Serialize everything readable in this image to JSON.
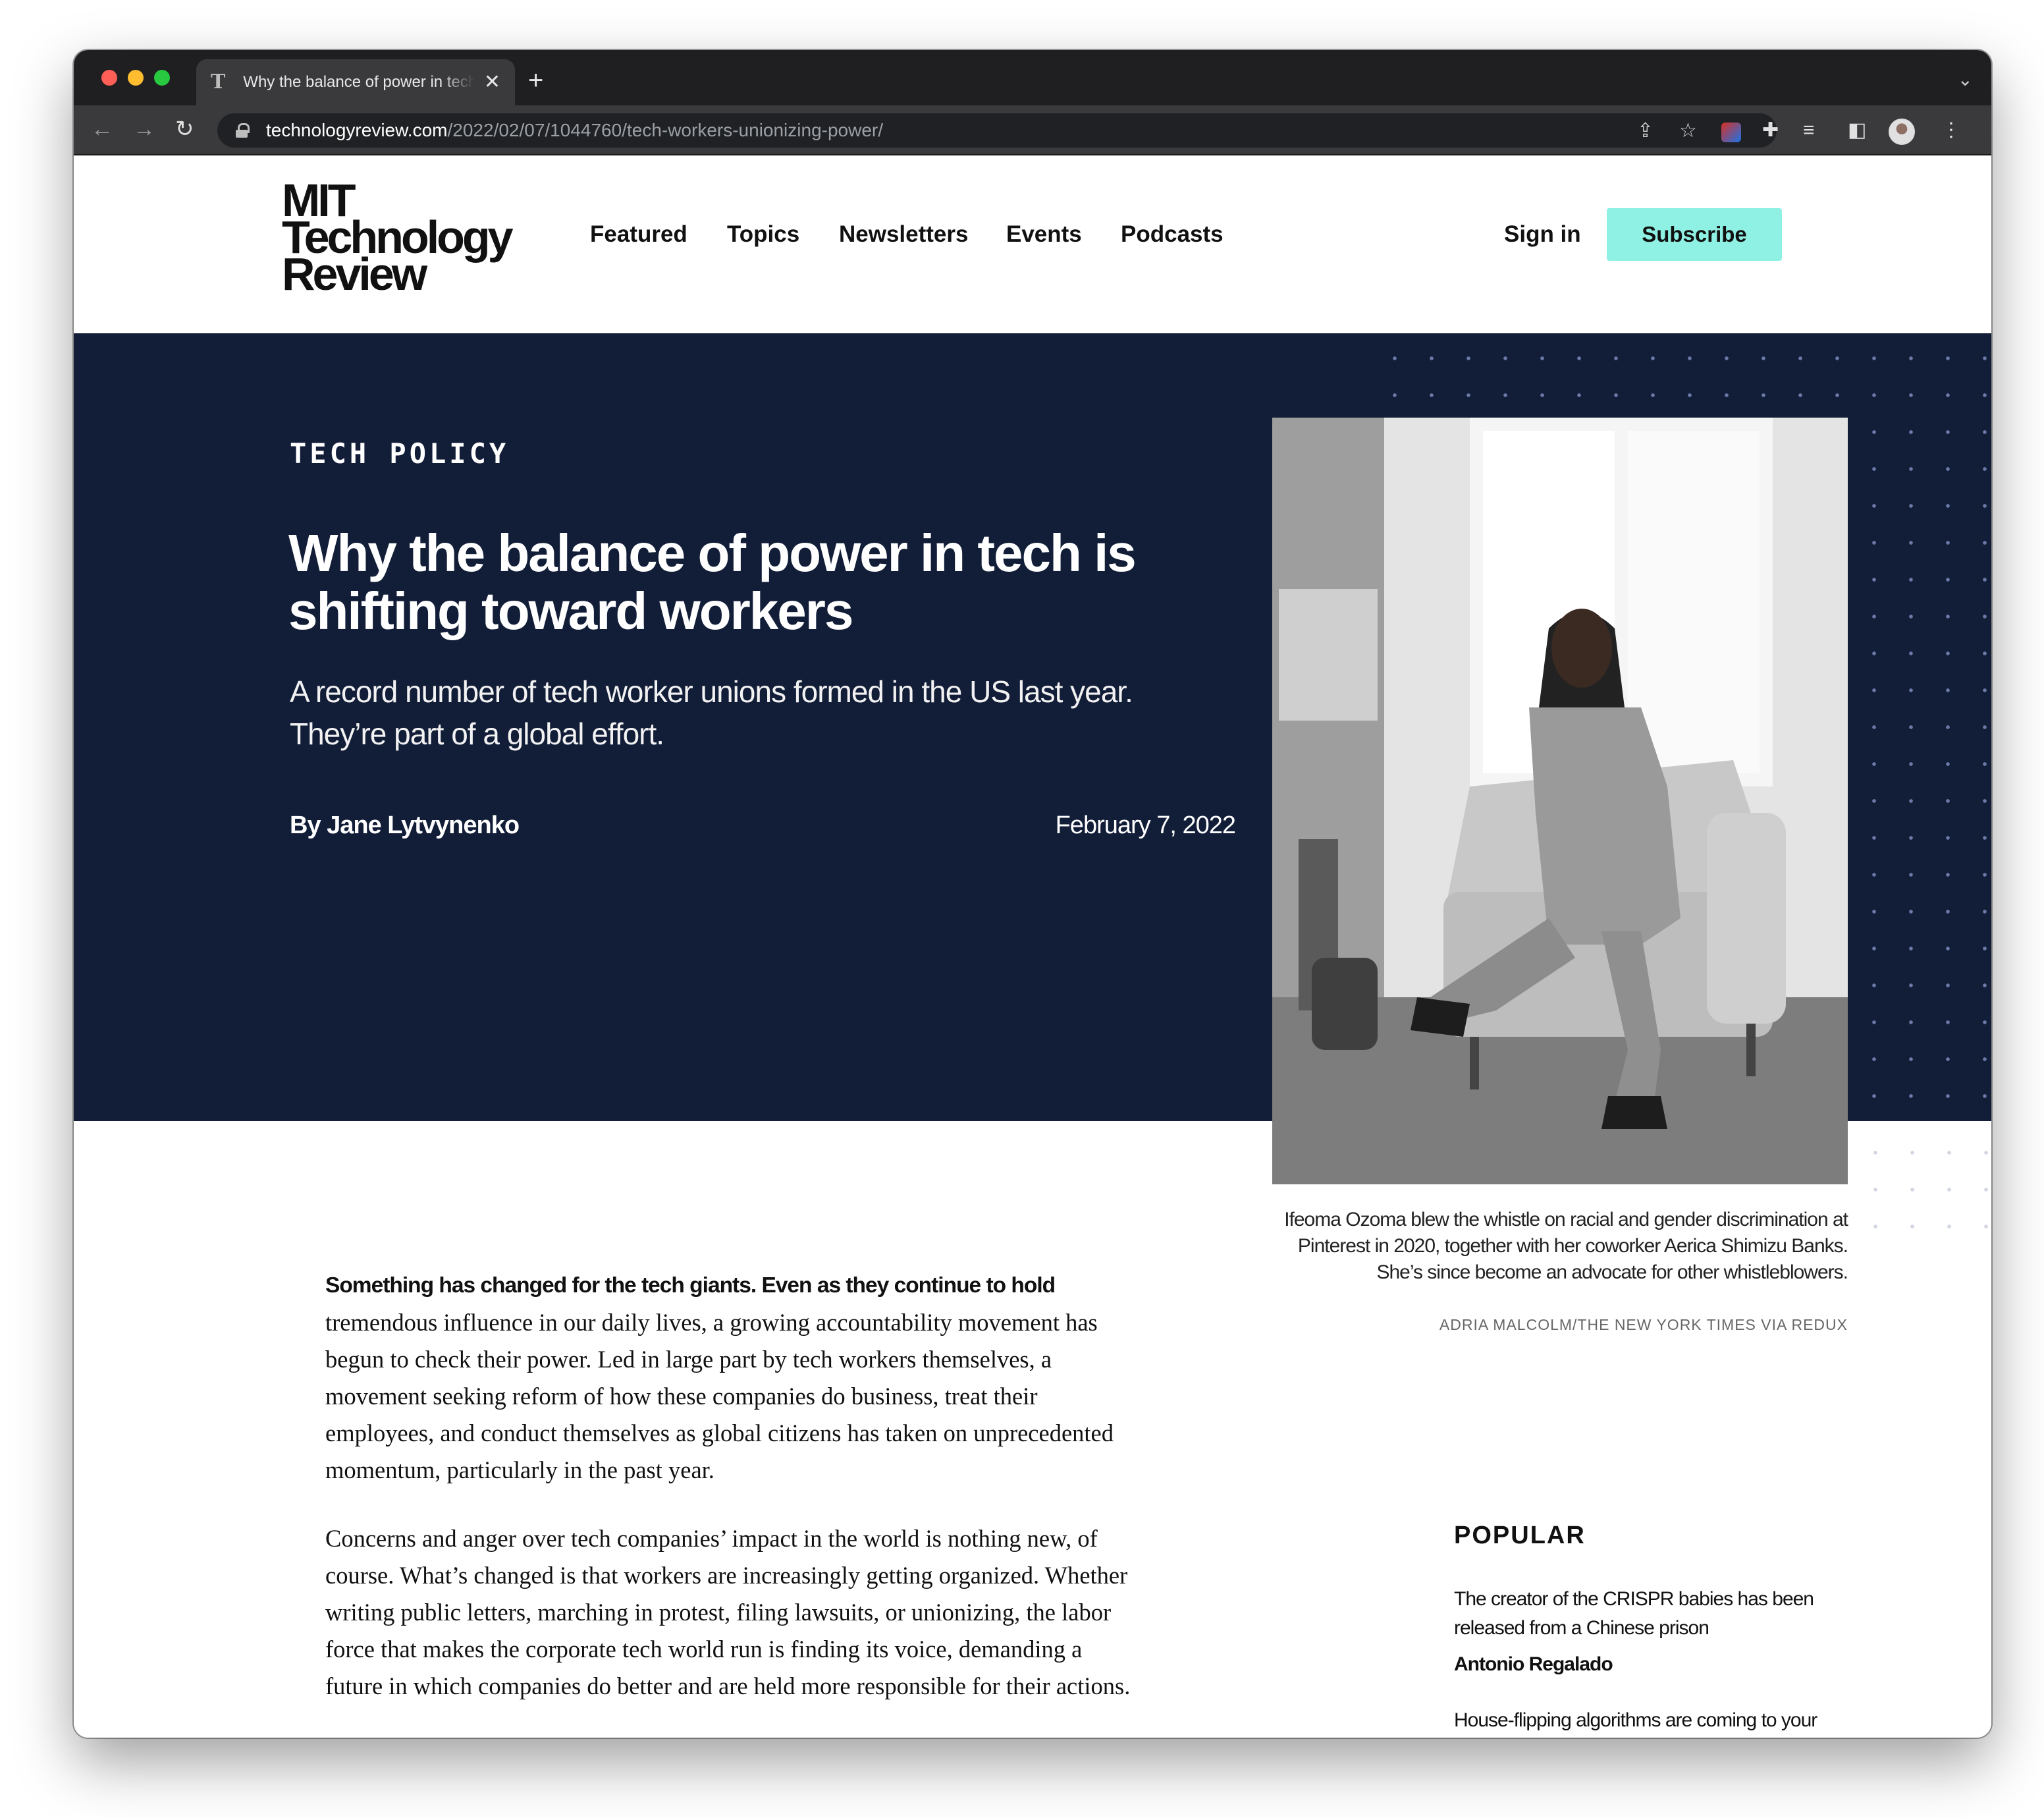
{
  "browser": {
    "tab_title": "Why the balance of power in tech is shifting toward workers",
    "tab_favicon": "T",
    "url_host": "technologyreview.com",
    "url_path": "/2022/02/07/1044760/tech-workers-unionizing-power/",
    "icons": [
      "back-icon",
      "forward-icon",
      "reload-icon",
      "lock-icon",
      "share-icon",
      "bookmark-star-icon",
      "extension-icon",
      "puzzle-icon",
      "media-icon",
      "sidebar-icon",
      "profile-avatar",
      "more-menu-icon"
    ]
  },
  "site": {
    "logo_lines": [
      "MIT",
      "Technology",
      "Review"
    ],
    "nav": [
      "Featured",
      "Topics",
      "Newsletters",
      "Events",
      "Podcasts"
    ],
    "sign_in": "Sign in",
    "subscribe": "Subscribe"
  },
  "article": {
    "section": "TECH POLICY",
    "headline": "Why the balance of power in tech is shifting toward workers",
    "dek": "A record number of tech worker unions formed in the US last year. They’re part of a global effort.",
    "byline": "By Jane Lytvynenko",
    "date": "February 7, 2022",
    "photo_caption": "Ifeoma Ozoma blew the whistle on racial and gender discrimination at Pinterest in 2020, together with her coworker Aerica Shimizu Banks. She’s since become an advocate for other whistleblowers.",
    "photo_credit": "ADRIA MALCOLM/THE NEW YORK TIMES VIA REDUX",
    "lede_bold": "Something has changed for the tech giants. Even as they continue to hold",
    "lede_rest": "tremendous influence in our daily lives, a growing accountability movement has begun to check their power. Led in large part by tech workers themselves, a movement seeking reform of how these companies do business, treat their employees, and conduct themselves as global citizens has taken on unprecedented momentum, particularly in the past year.",
    "paragraph_2": "Concerns and anger over tech companies’ impact in the world is nothing new, of course. What’s changed is that workers are increasingly getting organized. Whether writing public letters, marching in protest, filing lawsuits, or unionizing, the labor force that makes the corporate tech world run is finding its voice, demanding a future in which companies do better and are held more responsible for their actions."
  },
  "popular": {
    "heading": "POPULAR",
    "items": [
      {
        "title": "The creator of the CRISPR babies has been released from a Chinese prison",
        "author": "Antonio Regalado"
      },
      {
        "title": "House-flipping algorithms are coming to your neighborhood",
        "author": ""
      }
    ]
  },
  "colors": {
    "hero_bg": "#121d38",
    "subscribe_bg": "#8ff0e4",
    "dots": "#6b7aa8"
  }
}
